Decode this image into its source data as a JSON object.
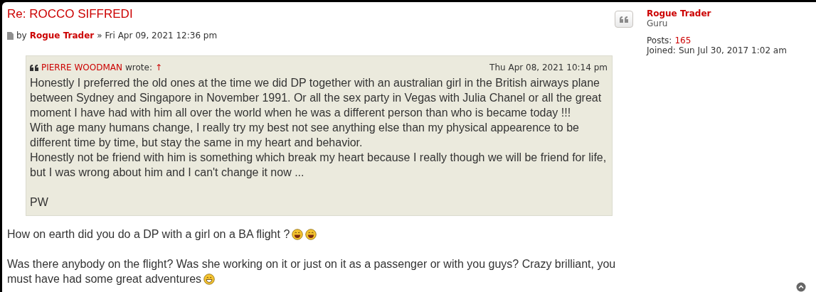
{
  "post": {
    "title": "Re: ROCCO SIFFREDI",
    "by": "by",
    "author": "Rogue Trader",
    "separator": "»",
    "date": "Fri Apr 09, 2021 12:36 pm",
    "quote": {
      "author": "PIERRE WOODMAN",
      "wrote": "wrote:",
      "link": "↑",
      "date": "Thu Apr 08, 2021 10:14 pm",
      "paragraphs": [
        "Honestly I preferred the old ones at the time we did DP together with an australian girl in the British airways plane between Sydney and Singapore in November 1991. Or all the sex party in Vegas with Julia Chanel or all the great moment I have had with him all over the world when he was a different person than who is became today !!!",
        "With age many humans change, I really try my best not see anything else than my physical appearence to be different time by time, but stay the same in my heart and behavior.",
        "Honestly not be friend with him is something which break my heart because I really though we will be friend for life, but I was wrong about him and I can't change it now ...",
        "PW"
      ]
    },
    "paragraphs": [
      {
        "lines": [
          "How on earth did you do a DP with a girl on a BA flight ?"
        ],
        "smileys": [
          {
            "kind": "laugh"
          },
          {
            "kind": "laugh"
          }
        ]
      },
      {
        "lines": [
          "Was there anybody on the flight? Was she working on it or just on it as a passenger or with you guys? Crazy brilliant, you",
          "must have had some great adventures"
        ],
        "smileys": [
          {
            "kind": "grin"
          }
        ]
      }
    ]
  },
  "profile": {
    "name": "Rogue Trader",
    "rank": "Guru",
    "posts_label": "Posts:",
    "posts": "165",
    "joined_label": "Joined:",
    "joined": "Sun Jul 30, 2017 1:02 am"
  }
}
